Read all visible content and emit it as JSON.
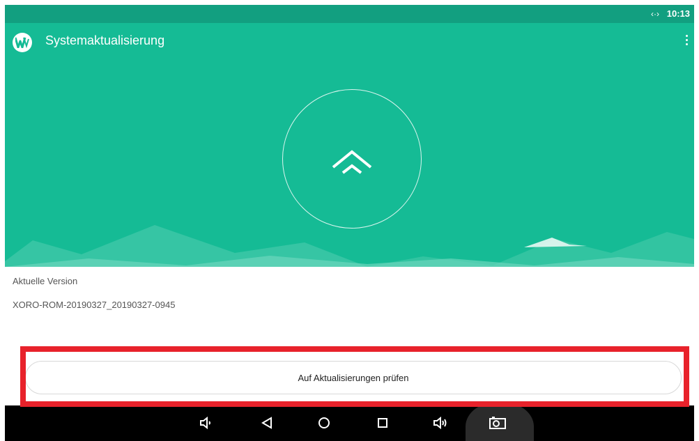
{
  "status_bar": {
    "network_icon": "data-transfer-icon",
    "network_glyph": "‹·›",
    "time": "10:13",
    "background": "#129F80"
  },
  "app_bar": {
    "title": "Systemaktualisierung",
    "logo_icon": "app-logo-icon",
    "menu_icon": "overflow-menu-icon"
  },
  "hero": {
    "background": "#15BB95",
    "update_icon": "double-chevron-up-icon"
  },
  "info": {
    "version_label": "Aktuelle Version",
    "version_value": "XORO-ROM-20190327_20190327-0945"
  },
  "actions": {
    "check_button_label": "Auf Aktualisierungen prüfen",
    "highlight_color": "#E8222B"
  },
  "nav_bar": {
    "items": [
      "volume-down-icon",
      "back-icon",
      "home-icon",
      "recents-icon",
      "volume-up-icon",
      "screenshot-camera-icon"
    ]
  }
}
